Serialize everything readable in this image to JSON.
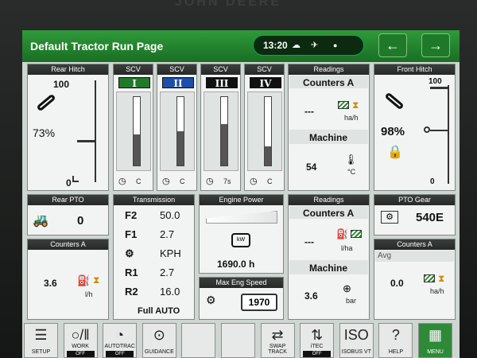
{
  "brand": "JOHN DEERE",
  "header": {
    "title": "Default Tractor Run Page",
    "time": "13:20"
  },
  "rear_hitch": {
    "title": "Rear Hitch",
    "top": "100",
    "bottom": "0",
    "percent": "73%",
    "level": 0.73
  },
  "scv": [
    {
      "title": "SCV",
      "label": "I",
      "color": "green",
      "footer": "C",
      "level": 0.45
    },
    {
      "title": "SCV",
      "label": "II",
      "color": "blue",
      "footer": "C",
      "level": 0.5
    },
    {
      "title": "SCV",
      "label": "III",
      "color": "black",
      "footer": "7s",
      "level": 0.6
    },
    {
      "title": "SCV",
      "label": "IV",
      "color": "black",
      "footer": "C",
      "level": 0.28
    }
  ],
  "readings_top": {
    "title": "Readings",
    "counters": "Counters A",
    "dash": "---",
    "unit": "ha/h",
    "machine": "Machine",
    "machine_value": "54",
    "machine_unit": "°C"
  },
  "front_hitch": {
    "title": "Front Hitch",
    "top": "100",
    "bottom": "0",
    "percent": "98%",
    "level": 0.98
  },
  "rear_pto": {
    "title": "Rear PTO",
    "value": "0"
  },
  "counters_left": {
    "title": "Counters A",
    "value": "3.6",
    "unit": "l/h"
  },
  "transmission": {
    "title": "Transmission",
    "rows": [
      {
        "gear": "F2",
        "value": "50.0"
      },
      {
        "gear": "F1",
        "value": "2.7"
      },
      {
        "gear": "⚙",
        "value": "KPH"
      },
      {
        "gear": "R1",
        "value": "2.7"
      },
      {
        "gear": "R2",
        "value": "16.0"
      }
    ],
    "mode": "Full AUTO"
  },
  "engine_power": {
    "title": "Engine Power",
    "hours": "1690.0 h",
    "unit": "kW"
  },
  "max_eng": {
    "title": "Max Eng Speed",
    "value": "1970"
  },
  "readings_mid": {
    "title": "Readings",
    "counters": "Counters A",
    "dash": "---",
    "unit": "l/ha",
    "machine": "Machine",
    "machine_value": "3.6",
    "machine_unit": "bar"
  },
  "pto_gear": {
    "title": "PTO Gear",
    "value": "540E"
  },
  "counters_right": {
    "title": "Counters A",
    "avg": "Avg",
    "value": "0.0",
    "unit": "ha/h"
  },
  "bottom": [
    {
      "label": "SETUP",
      "icon": "☰",
      "off": ""
    },
    {
      "label": "WORK",
      "icon": "○/‖",
      "off": "OFF"
    },
    {
      "label": "AUTOTRAC",
      "icon": "◔",
      "off": "OFF"
    },
    {
      "label": "GUIDANCE",
      "icon": "⊙",
      "off": ""
    },
    {
      "label": "",
      "icon": "",
      "off": ""
    },
    {
      "label": "",
      "icon": "",
      "off": ""
    },
    {
      "label": "SWAP TRACK",
      "icon": "⇄",
      "off": ""
    },
    {
      "label": "iTEC",
      "icon": "⇅",
      "off": "OFF"
    },
    {
      "label": "ISOBUS VT",
      "icon": "ISO",
      "off": ""
    },
    {
      "label": "HELP",
      "icon": "?",
      "off": ""
    },
    {
      "label": "MENU",
      "icon": "▦",
      "off": ""
    }
  ]
}
